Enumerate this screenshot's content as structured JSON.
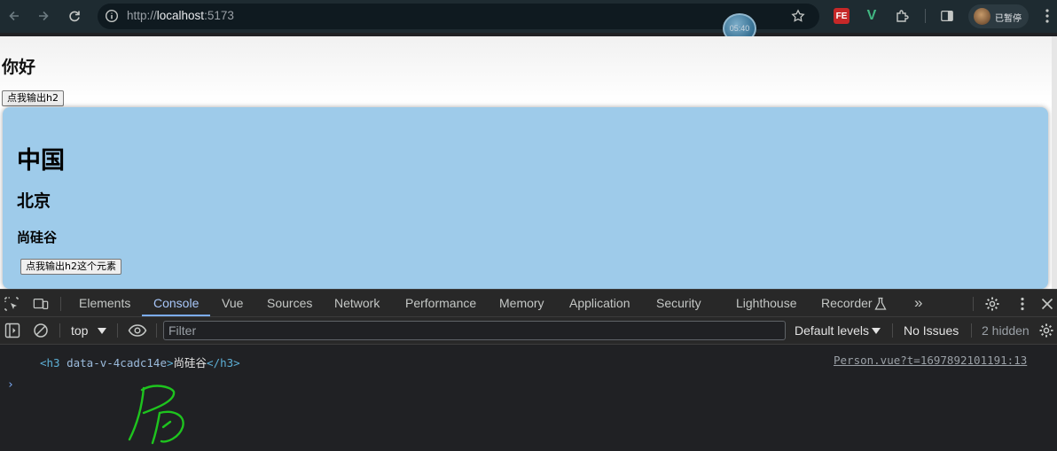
{
  "browser": {
    "url_prefix": "http://",
    "url_host": "localhost",
    "url_port": ":5173",
    "clock_overlay": "05:40",
    "ext_fe_label": "FE",
    "ext_v_label": "V",
    "profile_label": "已暂停",
    "icons": [
      "back-arrow-icon",
      "forward-arrow-icon",
      "reload-icon",
      "info-icon",
      "star-icon",
      "puzzle-icon",
      "side-panel-icon",
      "kebab-menu-icon"
    ]
  },
  "page": {
    "greeting": "你好",
    "top_button": "点我输出h2",
    "card": {
      "h_china": "中国",
      "h_beijing": "北京",
      "h_company": "尚硅谷",
      "button": "点我输出h2这个元素"
    },
    "colors": {
      "card_bg": "#9ecbea"
    }
  },
  "devtools": {
    "tabs": [
      "Elements",
      "Console",
      "Vue",
      "Sources",
      "Network",
      "Performance",
      "Memory",
      "Application",
      "Security",
      "Lighthouse",
      "Recorder"
    ],
    "active_tab": "Console",
    "more_tabs": "»",
    "console_bar": {
      "context": "top",
      "filter_placeholder": "Filter",
      "levels": "Default levels",
      "issues": "No Issues",
      "hidden": "2 hidden"
    },
    "log": {
      "open_tag": "<h3",
      "attribute": " data-v-4cadc14e",
      "open_close": ">",
      "text": "尚硅谷",
      "close_tag": "</h3>",
      "source": "Person.vue?t=1697892101191:13"
    },
    "prompt": "›",
    "accent": "#7cacf8"
  }
}
